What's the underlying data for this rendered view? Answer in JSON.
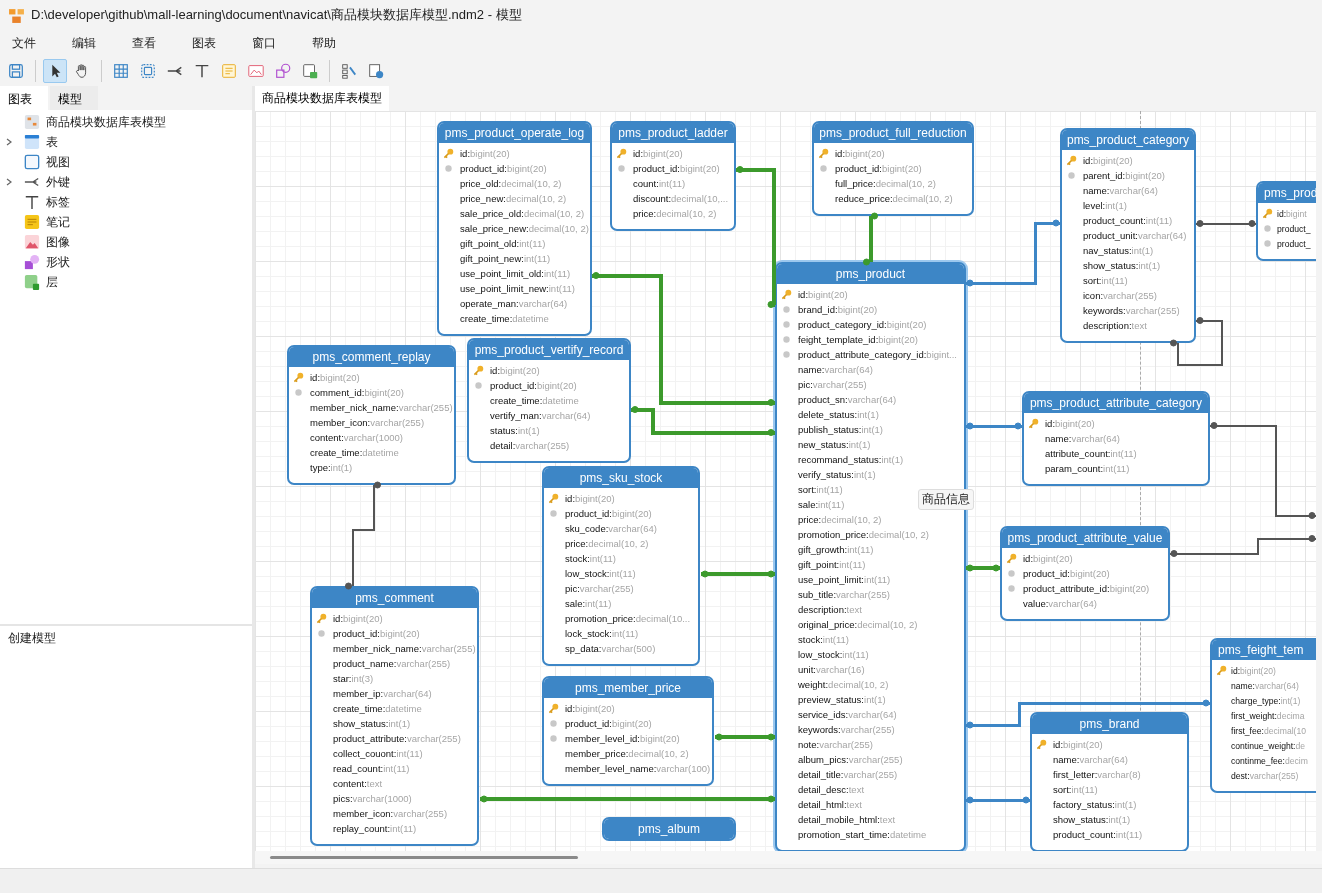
{
  "window": {
    "title": "D:\\developer\\github\\mall-learning\\document\\navicat\\商品模块数据库模型.ndm2 - 模型"
  },
  "menu": [
    "文件",
    "编辑",
    "查看",
    "图表",
    "窗口",
    "帮助"
  ],
  "toolbar": [
    [
      {
        "kind": "save",
        "selected": false
      }
    ],
    [
      {
        "kind": "pointer",
        "selected": true
      },
      {
        "kind": "hand",
        "selected": false
      }
    ],
    [
      {
        "kind": "table",
        "selected": false
      },
      {
        "kind": "view",
        "selected": false
      },
      {
        "kind": "relation",
        "selected": false
      },
      {
        "kind": "label",
        "selected": false
      },
      {
        "kind": "note",
        "selected": false
      },
      {
        "kind": "image",
        "selected": false
      },
      {
        "kind": "shape",
        "selected": false
      },
      {
        "kind": "layer",
        "selected": false
      }
    ],
    [
      {
        "kind": "layout",
        "selected": false
      },
      {
        "kind": "convert",
        "selected": false
      }
    ]
  ],
  "sidebar": {
    "tabs": [
      {
        "label": "图表",
        "selected": true
      },
      {
        "label": "模型",
        "selected": false
      }
    ],
    "items": [
      {
        "label": "商品模块数据库表模型",
        "kind": "model",
        "collapsed": false
      },
      {
        "label": "表",
        "kind": "table",
        "collapsed": true
      },
      {
        "label": "视图",
        "kind": "view",
        "collapsed": false
      },
      {
        "label": "外键",
        "kind": "relation",
        "collapsed": true
      },
      {
        "label": "标签",
        "kind": "label",
        "collapsed": false
      },
      {
        "label": "笔记",
        "kind": "note",
        "collapsed": false
      },
      {
        "label": "图像",
        "kind": "image",
        "collapsed": false
      },
      {
        "label": "形状",
        "kind": "shape",
        "collapsed": false
      },
      {
        "label": "层",
        "kind": "layer",
        "collapsed": false
      }
    ],
    "bottom_panel": "创建模型"
  },
  "diagram_tab": {
    "label": "商品模块数据库表模型",
    "selected": true
  },
  "canvas_label": "商品信息",
  "tables": [
    {
      "title": "pms_product_operate_log",
      "selected": false,
      "columns": [
        {
          "name": "id:",
          "type": "bigint(20)",
          "kind": "pk"
        },
        {
          "name": "product_id:",
          "type": "bigint(20)",
          "kind": "fk"
        },
        {
          "name": "price_old:",
          "type": "decimal(10, 2)",
          "kind": "col"
        },
        {
          "name": "price_new:",
          "type": "decimal(10, 2)",
          "kind": "col"
        },
        {
          "name": "sale_price_old:",
          "type": "decimal(10, 2)",
          "kind": "col"
        },
        {
          "name": "sale_price_new:",
          "type": "decimal(10, 2)",
          "kind": "col"
        },
        {
          "name": "gift_point_old:",
          "type": "int(11)",
          "kind": "col"
        },
        {
          "name": "gift_point_new:",
          "type": "int(11)",
          "kind": "col"
        },
        {
          "name": "use_point_limit_old:",
          "type": "int(11)",
          "kind": "col"
        },
        {
          "name": "use_point_limit_new:",
          "type": "int(11)",
          "kind": "col"
        },
        {
          "name": "operate_man:",
          "type": "varchar(64)",
          "kind": "col"
        },
        {
          "name": "create_time:",
          "type": "datetime",
          "kind": "col"
        }
      ]
    },
    {
      "title": "pms_product_ladder",
      "selected": false,
      "columns": [
        {
          "name": "id:",
          "type": "bigint(20)",
          "kind": "pk"
        },
        {
          "name": "product_id:",
          "type": "bigint(20)",
          "kind": "fk"
        },
        {
          "name": "count:",
          "type": "int(11)",
          "kind": "col"
        },
        {
          "name": "discount:",
          "type": "decimal(10,...",
          "kind": "col"
        },
        {
          "name": "price:",
          "type": "decimal(10, 2)",
          "kind": "col"
        }
      ]
    },
    {
      "title": "pms_product_full_reduction",
      "selected": false,
      "columns": [
        {
          "name": "id:",
          "type": "bigint(20)",
          "kind": "pk"
        },
        {
          "name": "product_id:",
          "type": "bigint(20)",
          "kind": "fk"
        },
        {
          "name": "full_price:",
          "type": "decimal(10, 2)",
          "kind": "col"
        },
        {
          "name": "reduce_price:",
          "type": "decimal(10, 2)",
          "kind": "col"
        }
      ]
    },
    {
      "title": "pms_product_category",
      "selected": false,
      "columns": [
        {
          "name": "id:",
          "type": "bigint(20)",
          "kind": "pk"
        },
        {
          "name": "parent_id:",
          "type": "bigint(20)",
          "kind": "fk"
        },
        {
          "name": "name:",
          "type": "varchar(64)",
          "kind": "col"
        },
        {
          "name": "level:",
          "type": "int(1)",
          "kind": "col"
        },
        {
          "name": "product_count:",
          "type": "int(11)",
          "kind": "col"
        },
        {
          "name": "product_unit:",
          "type": "varchar(64)",
          "kind": "col"
        },
        {
          "name": "nav_status:",
          "type": "int(1)",
          "kind": "col"
        },
        {
          "name": "show_status:",
          "type": "int(1)",
          "kind": "col"
        },
        {
          "name": "sort:",
          "type": "int(11)",
          "kind": "col"
        },
        {
          "name": "icon:",
          "type": "varchar(255)",
          "kind": "col"
        },
        {
          "name": "keywords:",
          "type": "varchar(255)",
          "kind": "col"
        },
        {
          "name": "description:",
          "type": "text",
          "kind": "col"
        }
      ]
    },
    {
      "title": "pms_prod",
      "selected": false,
      "columns": [
        {
          "name": "id:",
          "type": "bigint",
          "kind": "pk"
        },
        {
          "name": "product_",
          "kind": "fk"
        },
        {
          "name": "product_",
          "kind": "fk"
        }
      ]
    },
    {
      "title": "pms_comment_replay",
      "selected": false,
      "columns": [
        {
          "name": "id:",
          "type": "bigint(20)",
          "kind": "pk"
        },
        {
          "name": "comment_id:",
          "type": "bigint(20)",
          "kind": "fk"
        },
        {
          "name": "member_nick_name:",
          "type": "varchar(255)",
          "kind": "col"
        },
        {
          "name": "member_icon:",
          "type": "varchar(255)",
          "kind": "col"
        },
        {
          "name": "content:",
          "type": "varchar(1000)",
          "kind": "col"
        },
        {
          "name": "create_time:",
          "type": "datetime",
          "kind": "col"
        },
        {
          "name": "type:",
          "type": "int(1)",
          "kind": "col"
        }
      ]
    },
    {
      "title": "pms_product_vertify_record",
      "selected": false,
      "columns": [
        {
          "name": "id:",
          "type": "bigint(20)",
          "kind": "pk"
        },
        {
          "name": "product_id:",
          "type": "bigint(20)",
          "kind": "fk"
        },
        {
          "name": "create_time:",
          "type": "datetime",
          "kind": "col"
        },
        {
          "name": "vertify_man:",
          "type": "varchar(64)",
          "kind": "col"
        },
        {
          "name": "status:",
          "type": "int(1)",
          "kind": "col"
        },
        {
          "name": "detail:",
          "type": "varchar(255)",
          "kind": "col"
        }
      ]
    },
    {
      "title": "pms_product",
      "selected": true,
      "columns": [
        {
          "name": "id:",
          "type": "bigint(20)",
          "kind": "pk"
        },
        {
          "name": "brand_id:",
          "type": "bigint(20)",
          "kind": "fk"
        },
        {
          "name": "product_category_id:",
          "type": "bigint(20)",
          "kind": "fk"
        },
        {
          "name": "feight_template_id:",
          "type": "bigint(20)",
          "kind": "fk"
        },
        {
          "name": "product_attribute_category_id:",
          "type": "bigint...",
          "kind": "fk"
        },
        {
          "name": "name:",
          "type": "varchar(64)",
          "kind": "col"
        },
        {
          "name": "pic:",
          "type": "varchar(255)",
          "kind": "col"
        },
        {
          "name": "product_sn:",
          "type": "varchar(64)",
          "kind": "col"
        },
        {
          "name": "delete_status:",
          "type": "int(1)",
          "kind": "col"
        },
        {
          "name": "publish_status:",
          "type": "int(1)",
          "kind": "col"
        },
        {
          "name": "new_status:",
          "type": "int(1)",
          "kind": "col"
        },
        {
          "name": "recommand_status:",
          "type": "int(1)",
          "kind": "col"
        },
        {
          "name": "verify_status:",
          "type": "int(1)",
          "kind": "col"
        },
        {
          "name": "sort:",
          "type": "int(11)",
          "kind": "col"
        },
        {
          "name": "sale:",
          "type": "int(11)",
          "kind": "col"
        },
        {
          "name": "price:",
          "type": "decimal(10, 2)",
          "kind": "col"
        },
        {
          "name": "promotion_price:",
          "type": "decimal(10, 2)",
          "kind": "col"
        },
        {
          "name": "gift_growth:",
          "type": "int(11)",
          "kind": "col"
        },
        {
          "name": "gift_point:",
          "type": "int(11)",
          "kind": "col"
        },
        {
          "name": "use_point_limit:",
          "type": "int(11)",
          "kind": "col"
        },
        {
          "name": "sub_title:",
          "type": "varchar(255)",
          "kind": "col"
        },
        {
          "name": "description:",
          "type": "text",
          "kind": "col"
        },
        {
          "name": "original_price:",
          "type": "decimal(10, 2)",
          "kind": "col"
        },
        {
          "name": "stock:",
          "type": "int(11)",
          "kind": "col"
        },
        {
          "name": "low_stock:",
          "type": "int(11)",
          "kind": "col"
        },
        {
          "name": "unit:",
          "type": "varchar(16)",
          "kind": "col"
        },
        {
          "name": "weight:",
          "type": "decimal(10, 2)",
          "kind": "col"
        },
        {
          "name": "preview_status:",
          "type": "int(1)",
          "kind": "col"
        },
        {
          "name": "service_ids:",
          "type": "varchar(64)",
          "kind": "col"
        },
        {
          "name": "keywords:",
          "type": "varchar(255)",
          "kind": "col"
        },
        {
          "name": "note:",
          "type": "varchar(255)",
          "kind": "col"
        },
        {
          "name": "album_pics:",
          "type": "varchar(255)",
          "kind": "col"
        },
        {
          "name": "detail_title:",
          "type": "varchar(255)",
          "kind": "col"
        },
        {
          "name": "detail_desc:",
          "type": "text",
          "kind": "col"
        },
        {
          "name": "detail_html:",
          "type": "text",
          "kind": "col"
        },
        {
          "name": "detail_mobile_html:",
          "type": "text",
          "kind": "col"
        },
        {
          "name": "promotion_start_time:",
          "type": "datetime",
          "kind": "col"
        }
      ]
    },
    {
      "title": "pms_product_attribute_category",
      "selected": false,
      "columns": [
        {
          "name": "id:",
          "type": "bigint(20)",
          "kind": "pk"
        },
        {
          "name": "name:",
          "type": "varchar(64)",
          "kind": "col"
        },
        {
          "name": "attribute_count:",
          "type": "int(11)",
          "kind": "col"
        },
        {
          "name": "param_count:",
          "type": "int(11)",
          "kind": "col"
        }
      ]
    },
    {
      "title": "pms_sku_stock",
      "selected": false,
      "columns": [
        {
          "name": "id:",
          "type": "bigint(20)",
          "kind": "pk"
        },
        {
          "name": "product_id:",
          "type": "bigint(20)",
          "kind": "fk"
        },
        {
          "name": "sku_code:",
          "type": "varchar(64)",
          "kind": "col"
        },
        {
          "name": "price:",
          "type": "decimal(10, 2)",
          "kind": "col"
        },
        {
          "name": "stock:",
          "type": "int(11)",
          "kind": "col"
        },
        {
          "name": "low_stock:",
          "type": "int(11)",
          "kind": "col"
        },
        {
          "name": "pic:",
          "type": "varchar(255)",
          "kind": "col"
        },
        {
          "name": "sale:",
          "type": "int(11)",
          "kind": "col"
        },
        {
          "name": "promotion_price:",
          "type": "decimal(10...",
          "kind": "col"
        },
        {
          "name": "lock_stock:",
          "type": "int(11)",
          "kind": "col"
        },
        {
          "name": "sp_data:",
          "type": "varchar(500)",
          "kind": "col"
        }
      ]
    },
    {
      "title": "pms_product_attribute_value",
      "selected": false,
      "columns": [
        {
          "name": "id:",
          "type": "bigint(20)",
          "kind": "pk"
        },
        {
          "name": "product_id:",
          "type": "bigint(20)",
          "kind": "fk"
        },
        {
          "name": "product_attribute_id:",
          "type": "bigint(20)",
          "kind": "fk"
        },
        {
          "name": "value:",
          "type": "varchar(64)",
          "kind": "col"
        }
      ]
    },
    {
      "title": "pms_comment",
      "selected": false,
      "columns": [
        {
          "name": "id:",
          "type": "bigint(20)",
          "kind": "pk"
        },
        {
          "name": "product_id:",
          "type": "bigint(20)",
          "kind": "fk"
        },
        {
          "name": "member_nick_name:",
          "type": "varchar(255)",
          "kind": "col"
        },
        {
          "name": "product_name:",
          "type": "varchar(255)",
          "kind": "col"
        },
        {
          "name": "star:",
          "type": "int(3)",
          "kind": "col"
        },
        {
          "name": "member_ip:",
          "type": "varchar(64)",
          "kind": "col"
        },
        {
          "name": "create_time:",
          "type": "datetime",
          "kind": "col"
        },
        {
          "name": "show_status:",
          "type": "int(1)",
          "kind": "col"
        },
        {
          "name": "product_attribute:",
          "type": "varchar(255)",
          "kind": "col"
        },
        {
          "name": "collect_couont:",
          "type": "int(11)",
          "kind": "col"
        },
        {
          "name": "read_count:",
          "type": "int(11)",
          "kind": "col"
        },
        {
          "name": "content:",
          "type": "text",
          "kind": "col"
        },
        {
          "name": "pics:",
          "type": "varchar(1000)",
          "kind": "col"
        },
        {
          "name": "member_icon:",
          "type": "varchar(255)",
          "kind": "col"
        },
        {
          "name": "replay_count:",
          "type": "int(11)",
          "kind": "col"
        }
      ]
    },
    {
      "title": "pms_member_price",
      "selected": false,
      "columns": [
        {
          "name": "id:",
          "type": "bigint(20)",
          "kind": "pk"
        },
        {
          "name": "product_id:",
          "type": "bigint(20)",
          "kind": "fk"
        },
        {
          "name": "member_level_id:",
          "type": "bigint(20)",
          "kind": "fk"
        },
        {
          "name": "member_price:",
          "type": "decimal(10, 2)",
          "kind": "col"
        },
        {
          "name": "member_level_name:",
          "type": "varchar(100)",
          "kind": "col"
        }
      ]
    },
    {
      "title": "pms_album",
      "selected": false
    },
    {
      "title": "pms_feight_tem",
      "selected": false,
      "columns": [
        {
          "name": "id:",
          "type": "bigint(20)",
          "kind": "pk"
        },
        {
          "name": "name:",
          "type": "varchar(64)",
          "kind": "col"
        },
        {
          "name": "charge_type:",
          "type": "int(1)",
          "kind": "col"
        },
        {
          "name": "first_weight:",
          "type": "decima",
          "kind": "col"
        },
        {
          "name": "first_fee:",
          "type": "decimal(10",
          "kind": "col"
        },
        {
          "name": "continue_weight:",
          "type": "de",
          "kind": "col"
        },
        {
          "name": "continme_fee:",
          "type": "decim",
          "kind": "col"
        },
        {
          "name": "dest:",
          "type": "varchar(255)",
          "kind": "col"
        }
      ]
    },
    {
      "title": "pms_brand",
      "selected": false,
      "columns": [
        {
          "name": "id:",
          "type": "bigint(20)",
          "kind": "pk"
        },
        {
          "name": "name:",
          "type": "varchar(64)",
          "kind": "col"
        },
        {
          "name": "first_letter:",
          "type": "varchar(8)",
          "kind": "col"
        },
        {
          "name": "sort:",
          "type": "int(11)",
          "kind": "col"
        },
        {
          "name": "factory_status:",
          "type": "int(1)",
          "kind": "col"
        },
        {
          "name": "show_status:",
          "type": "int(1)",
          "kind": "col"
        },
        {
          "name": "product_count:",
          "type": "int(11)",
          "kind": "col"
        }
      ]
    }
  ],
  "relations": [
    {
      "color": "#3c9a2c"
    },
    {
      "color": "#3c9a2c"
    },
    {
      "color": "#3c9a2c"
    },
    {
      "color": "#3c9a2c"
    },
    {
      "color": "#3c9a2c"
    },
    {
      "color": "#3c9a2c"
    },
    {
      "color": "#3c9a2c"
    },
    {
      "color": "#3c9a2c"
    },
    {
      "color": "#3d86c6"
    },
    {
      "color": "#3d86c6"
    },
    {
      "color": "#3d86c6"
    },
    {
      "color": "#3d86c6"
    },
    {
      "color": "#555555"
    },
    {
      "color": "#555555"
    },
    {
      "color": "#555555"
    },
    {
      "color": "#555555"
    },
    {
      "color": "#555555"
    }
  ]
}
